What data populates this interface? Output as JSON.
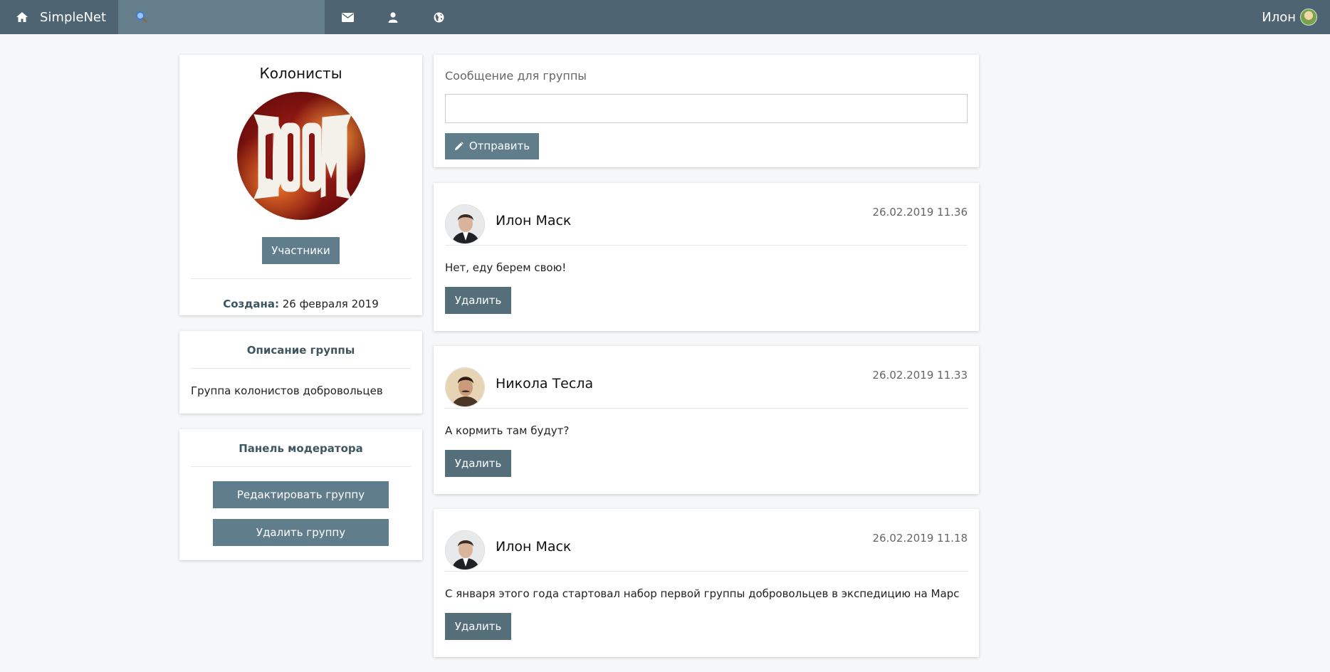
{
  "topbar": {
    "brand": "SimpleNet",
    "search_placeholder": "",
    "nav_icons": [
      "envelope-icon",
      "user-icon",
      "globe-icon"
    ],
    "user_name": "Илон"
  },
  "group": {
    "title": "Колонисты",
    "avatar_logo_text": "DOOM",
    "members_button": "Участники",
    "created_label": "Создана:",
    "created_value": "26 февраля 2019"
  },
  "description": {
    "heading": "Описание группы",
    "text": "Группа колонистов добровольцев"
  },
  "moderator": {
    "heading": "Панель модератора",
    "edit_button": "Редактировать группу",
    "delete_button": "Удалить группу"
  },
  "compose": {
    "label": "Сообщение для группы",
    "input_value": "",
    "send_button": "Отправить"
  },
  "posts": [
    {
      "author": "Илон Маск",
      "date": "26.02.2019 11.36",
      "text": "Нет, еду берем свою!",
      "delete_button": "Удалить"
    },
    {
      "author": "Никола Тесла",
      "date": "26.02.2019 11.33",
      "text": "А кормить там будут?",
      "delete_button": "Удалить"
    },
    {
      "author": "Илон Маск",
      "date": "26.02.2019 11.18",
      "text": "С января этого года стартовал набор первой группы добровольцев в экспедицию на Марс",
      "delete_button": "Удалить"
    }
  ],
  "colors": {
    "topbar": "#4e6472",
    "search": "#657e8b",
    "button": "#607d8b",
    "button_dark": "#546e7a",
    "background": "#f5f7f8"
  }
}
